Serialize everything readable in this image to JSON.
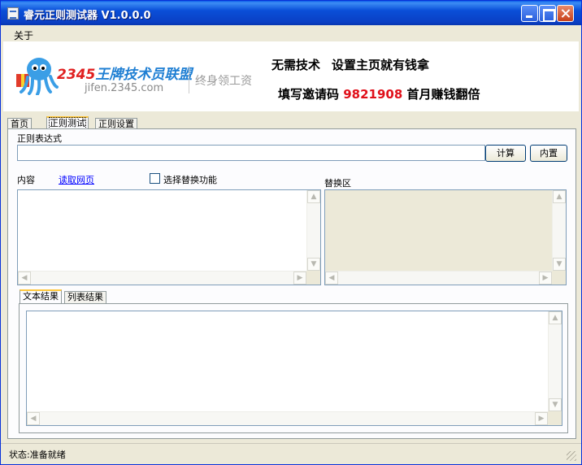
{
  "window": {
    "title": "睿元正则测试器 V1.0.0.0"
  },
  "menu": {
    "about": "关于"
  },
  "banner": {
    "logo_num": "2345",
    "logo_text": "王牌技术员联盟",
    "logo_url": "jifen.2345.com",
    "slogan": "终身领工资",
    "promo_left": "无需技术",
    "promo_right": "设置主页就有钱拿",
    "promo2_prefix": "填写邀请码",
    "promo2_code": "9821908",
    "promo2_suffix": "首月赚钱翻倍"
  },
  "tabs": [
    "首页",
    "正则测试",
    "正则设置"
  ],
  "form": {
    "regex_label": "正则表达式",
    "regex_value": "",
    "calc_button": "计算",
    "builtin_button": "内置",
    "content_label": "内容",
    "read_link": "读取网页",
    "replace_checkbox": "选择替换功能",
    "replace_label": "替换区"
  },
  "result_tabs": [
    "文本结果",
    "列表结果"
  ],
  "status": {
    "text": "状态:准备就绪"
  }
}
